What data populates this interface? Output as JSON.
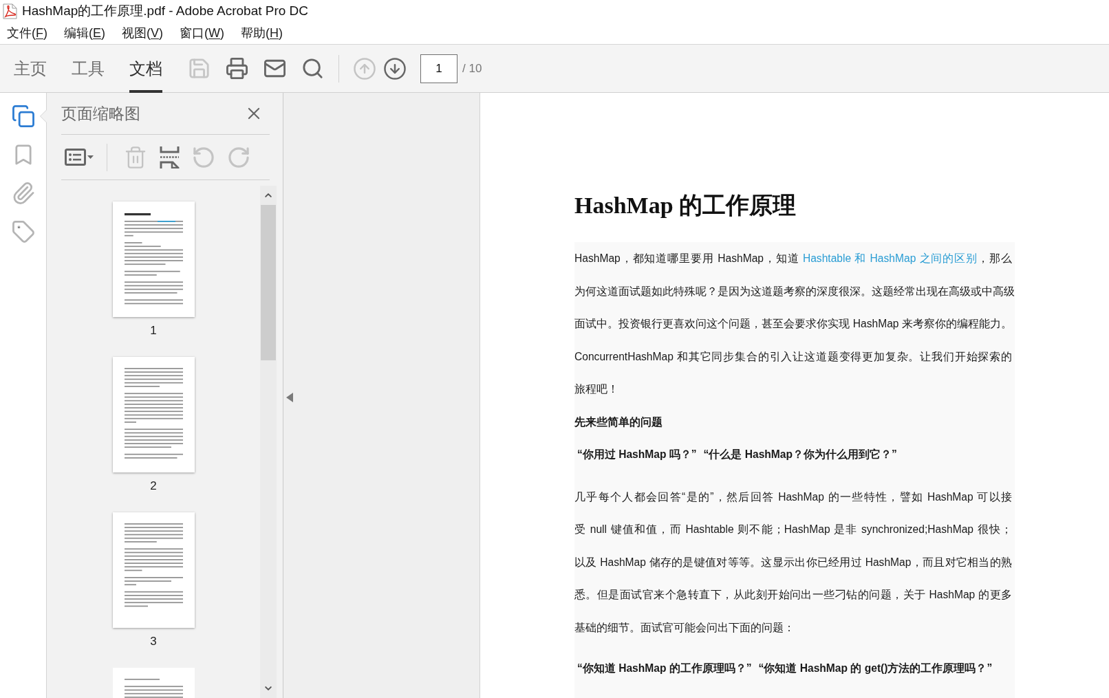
{
  "window": {
    "title": "HashMap的工作原理.pdf - Adobe Acrobat Pro DC"
  },
  "menu": [
    {
      "parts": [
        "文件(",
        "F",
        ")"
      ]
    },
    {
      "parts": [
        "编辑(",
        "E",
        ")"
      ]
    },
    {
      "parts": [
        "视图(",
        "V",
        ")"
      ]
    },
    {
      "parts": [
        "窗口(",
        "W",
        ")"
      ]
    },
    {
      "parts": [
        "帮助(",
        "H",
        ")"
      ]
    }
  ],
  "toolbar": {
    "tabs": [
      {
        "label": "主页",
        "selected": false
      },
      {
        "label": "工具",
        "selected": false
      },
      {
        "label": "文档",
        "selected": true
      }
    ],
    "tools": [
      {
        "kind": "save",
        "disabled": true
      },
      {
        "kind": "print",
        "disabled": false
      },
      {
        "kind": "email",
        "disabled": false
      },
      {
        "kind": "find",
        "disabled": false
      }
    ],
    "page_nav": {
      "buttons": [
        {
          "kind": "previous",
          "disabled": true
        },
        {
          "kind": "next",
          "disabled": false
        }
      ],
      "current_page": "1",
      "total": "/ 10"
    }
  },
  "sidebar": {
    "items": [
      {
        "kind": "pages",
        "selected": true
      },
      {
        "kind": "bookmarks",
        "selected": false
      },
      {
        "kind": "attachments",
        "selected": false
      },
      {
        "kind": "tags",
        "selected": false
      }
    ]
  },
  "thumbnail_panel": {
    "title": "页面缩略图",
    "tools": [
      {
        "kind": "options",
        "disabled": false
      },
      {
        "kind": "delete",
        "disabled": true
      },
      {
        "kind": "insert",
        "disabled": false
      },
      {
        "kind": "rotate_left",
        "disabled": true
      },
      {
        "kind": "rotate_right",
        "disabled": true
      }
    ],
    "thumbnails": [
      {
        "label": "1",
        "cut_off": false
      },
      {
        "label": "2",
        "cut_off": false
      },
      {
        "label": "3",
        "cut_off": false
      },
      {
        "cut_off": true
      }
    ]
  },
  "document": {
    "title": "HashMap 的工作原理",
    "blocks": [
      {
        "kind": "paragraph",
        "lines": [
          [
            {
              "kind": "text",
              "text": "HashMap，都知道哪里要用 HashMap，知道 "
            },
            {
              "kind": "link",
              "text": "Hashtable 和 HashMap 之间的区别"
            },
            {
              "kind": "text",
              "text": "，那么"
            }
          ],
          [
            {
              "kind": "text",
              "text": "为何这道面试题如此特殊呢？是因为这道题考察的深度很深。这题经常出现在高级或中高级"
            }
          ],
          [
            {
              "kind": "text",
              "text": "面试中。投资银行更喜欢问这个问题，甚至会要求你实现 HashMap 来考察你的编程能力。"
            }
          ],
          [
            {
              "kind": "text",
              "text": "ConcurrentHashMap 和其它同步集合的引入让这道题变得更加复杂。让我们开始探索的"
            }
          ],
          [
            {
              "kind": "text",
              "text": "旅程吧！"
            }
          ]
        ]
      },
      {
        "kind": "heading",
        "text": "先来些简单的问题"
      },
      {
        "kind": "questions",
        "items": [
          "“你用过 HashMap 吗？”",
          "“什么是 HashMap？你为什么用到它？”"
        ]
      },
      {
        "kind": "paragraph",
        "lines": [
          [
            {
              "kind": "text",
              "text": "几乎每个人都会回答“是的”，然后回答 HashMap 的一些特性，譬如 HashMap 可以接"
            }
          ],
          [
            {
              "kind": "text",
              "text": "受 null 键值和值，而 Hashtable 则不能；HashMap 是非 synchronized;HashMap 很快；"
            }
          ],
          [
            {
              "kind": "text",
              "text": "以及 HashMap 储存的是键值对等等。这显示出你已经用过 HashMap，而且对它相当的熟"
            }
          ],
          [
            {
              "kind": "text",
              "text": "悉。但是面试官来个急转直下，从此刻开始问出一些刁钻的问题，关于 HashMap 的更多"
            }
          ],
          [
            {
              "kind": "text",
              "text": "基础的细节。面试官可能会问出下面的问题："
            }
          ]
        ]
      },
      {
        "kind": "questions",
        "items": [
          "“你知道 HashMap 的工作原理吗？”",
          "“你知道 HashMap 的 get()方法的工作原理吗？”"
        ]
      }
    ]
  }
}
